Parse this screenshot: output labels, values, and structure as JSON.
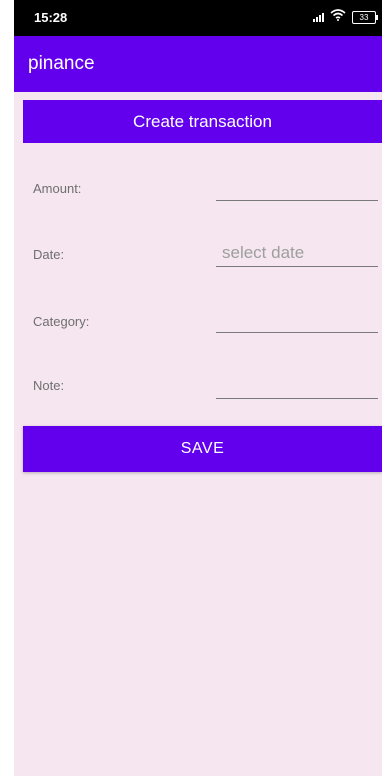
{
  "status_bar": {
    "time": "15:28",
    "battery": "33",
    "icons": [
      "signal-icon",
      "wifi-icon",
      "battery-icon"
    ]
  },
  "app_bar": {
    "title": "pinance",
    "color": "#6200ee"
  },
  "form": {
    "header": "Create transaction",
    "fields": {
      "amount": {
        "label": "Amount:",
        "value": ""
      },
      "date": {
        "label": "Date:",
        "placeholder": "select date"
      },
      "category": {
        "label": "Category:",
        "value": ""
      },
      "note": {
        "label": "Note:",
        "value": ""
      }
    },
    "save_label": "SAVE"
  },
  "colors": {
    "accent": "#6200ee",
    "background": "#f5e6f0"
  }
}
